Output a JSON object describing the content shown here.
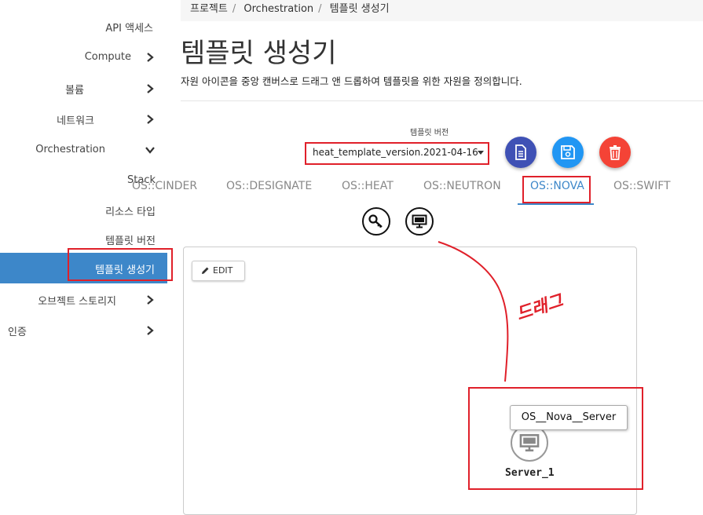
{
  "breadcrumb": [
    "프로젝트",
    "Orchestration",
    "템플릿 생성기"
  ],
  "sidebar": {
    "items": [
      {
        "label": "API 액세스"
      },
      {
        "label": "Compute"
      },
      {
        "label": "볼륨"
      },
      {
        "label": "네트워크"
      },
      {
        "label": "Orchestration"
      },
      {
        "label": "Stack"
      },
      {
        "label": "리소스 타입"
      },
      {
        "label": "템플릿 버전"
      },
      {
        "label": "템플릿 생성기"
      },
      {
        "label": "오브젝트 스토리지"
      },
      {
        "label": "인증"
      }
    ]
  },
  "page": {
    "title": "템플릿 생성기",
    "description": "자원 아이콘을 중앙 캔버스로 드래그 앤 드롭하여 템플릿을 위한 자원을 정의합니다."
  },
  "version": {
    "label": "템플릿 버전",
    "selected": "heat_template_version.2021-04-16"
  },
  "tabs": [
    {
      "label": "OS::CINDER"
    },
    {
      "label": "OS::DESIGNATE"
    },
    {
      "label": "OS::HEAT"
    },
    {
      "label": "OS::NEUTRON"
    },
    {
      "label": "OS::NOVA"
    },
    {
      "label": "OS::SWIFT"
    }
  ],
  "canvas": {
    "edit_label": "EDIT",
    "tooltip": "OS__Nova__Server",
    "node_label": "Server_1"
  },
  "annotation": {
    "drag_text": "드래그"
  },
  "colors": {
    "accent": "#3d87c9",
    "doc_btn": "#3f51b5",
    "save_btn": "#2196f3",
    "delete_btn": "#f44336",
    "annotation": "#e0202a"
  },
  "icons": [
    "chevron-right-icon",
    "chevron-down-icon",
    "document-icon",
    "save-icon",
    "trash-icon",
    "key-icon",
    "monitor-icon",
    "pencil-icon"
  ]
}
